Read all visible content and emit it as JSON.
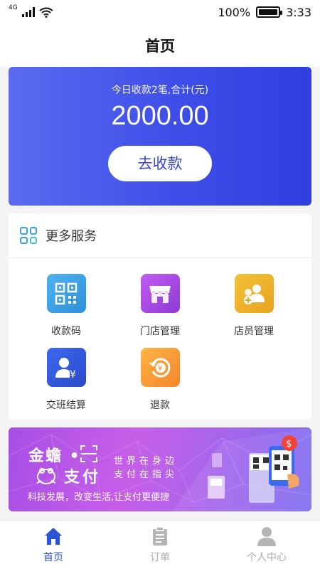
{
  "status": {
    "network": "4G",
    "battery_percent": "100%",
    "time": "3:33"
  },
  "header": {
    "title": "首页"
  },
  "summary": {
    "caption": "今日收款2笔,合计(元)",
    "amount": "2000.00",
    "collect_button": "去收款"
  },
  "services": {
    "title": "更多服务",
    "items": [
      {
        "label": "收款码",
        "icon": "qr-code-icon"
      },
      {
        "label": "门店管理",
        "icon": "store-icon"
      },
      {
        "label": "店员管理",
        "icon": "staff-icon"
      },
      {
        "label": "交班结算",
        "icon": "shift-settlement-icon"
      },
      {
        "label": "退款",
        "icon": "refund-icon"
      }
    ]
  },
  "banner": {
    "brand": "金蟾 •",
    "brand_line2": "支付",
    "slogan_line1": "世界在身边",
    "slogan_line2": "支付在指尖",
    "tagline": "科技发展，改变生活,让支付更便捷"
  },
  "tabbar": {
    "tabs": [
      {
        "label": "首页",
        "active": true
      },
      {
        "label": "订单",
        "active": false
      },
      {
        "label": "个人中心",
        "active": false
      }
    ]
  },
  "colors": {
    "accent": "#2d53d6",
    "hero_gradient_start": "#5a6bf0",
    "hero_gradient_end": "#2f3fe0",
    "banner_purple": "#a74fe6"
  }
}
